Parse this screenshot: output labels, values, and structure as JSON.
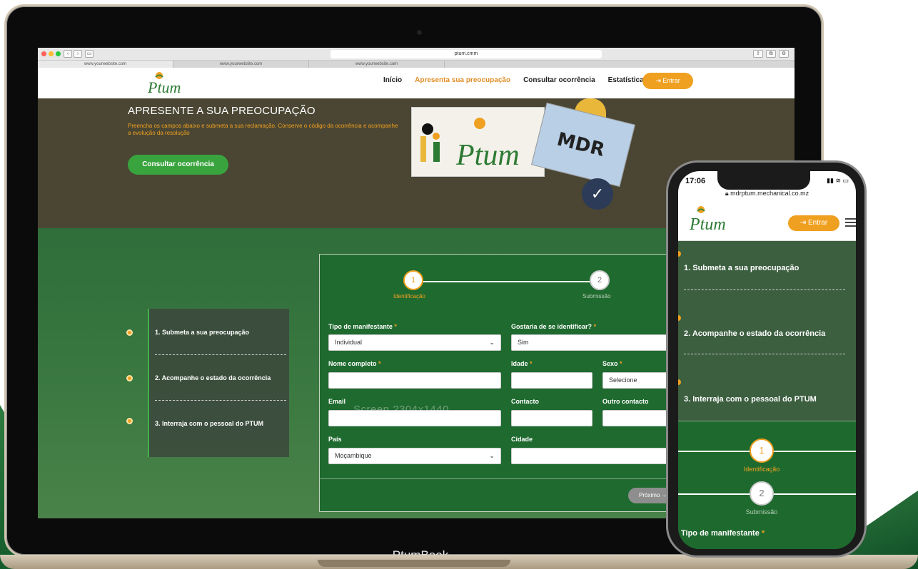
{
  "browser": {
    "address": "ptum.cmm",
    "tabs": [
      "www.yourwebsite.com",
      "www.yourwebsite.com",
      "www.yourwebsite.com"
    ]
  },
  "site": {
    "logo_text": "Ptum",
    "nav": [
      "Início",
      "Apresenta sua preocupação",
      "Consultar ocorrência",
      "Estatísticas"
    ],
    "entrar_label": "Entrar"
  },
  "hero": {
    "title": "APRESENTE A SUA PREOCUPAÇÃO",
    "subtitle": "Preencha os campos abaixo e submeta a sua reclamação. Conserve o código da ocorrência e acompanhe a evolução da resolução",
    "button_label": "Consultar ocorrência",
    "card_logo": "Ptum",
    "card_tag": "MDR"
  },
  "steps": [
    "1. Submeta a sua preocupação",
    "2. Acompanhe o estado da ocorrência",
    "3. Interraja com o pessoal do PTUM"
  ],
  "form": {
    "stepper": [
      {
        "number": "1",
        "label": "Identificação"
      },
      {
        "number": "2",
        "label": "Submissão"
      }
    ],
    "fields": {
      "tipo_label": "Tipo de manifestante",
      "tipo_value": "Individual",
      "identificar_label": "Gostaria de se identificar?",
      "identificar_value": "Sim",
      "nome_label": "Nome completo",
      "idade_label": "Idade",
      "sexo_label": "Sexo",
      "sexo_value": "Selecione",
      "email_label": "Email",
      "contacto_label": "Contacto",
      "outro_label": "Outro contacto",
      "pais_label": "País",
      "pais_value": "Moçambique",
      "cidade_label": "Cidade"
    },
    "required_mark": "*",
    "next_label": "Próximo"
  },
  "watermark": "Screen 2304x1440",
  "laptop_label": "PtumBook",
  "phone": {
    "time": "17:06",
    "url": "mdrptum.mechanical.co.mz",
    "entrar_label": "Entrar",
    "steps": [
      "1. Submeta a sua preocupação",
      "2. Acompanhe o estado da ocorrência",
      "3. Interraja com o pessoal do PTUM"
    ],
    "stepper": [
      {
        "number": "1",
        "label": "Identificação"
      },
      {
        "number": "2",
        "label": "Submissão"
      }
    ],
    "field_label": "Tipo de manifestante",
    "required_mark": "*"
  },
  "colors": {
    "accent": "#f0a020",
    "brand_green": "#1f6a2f",
    "button_green": "#39a33e"
  }
}
